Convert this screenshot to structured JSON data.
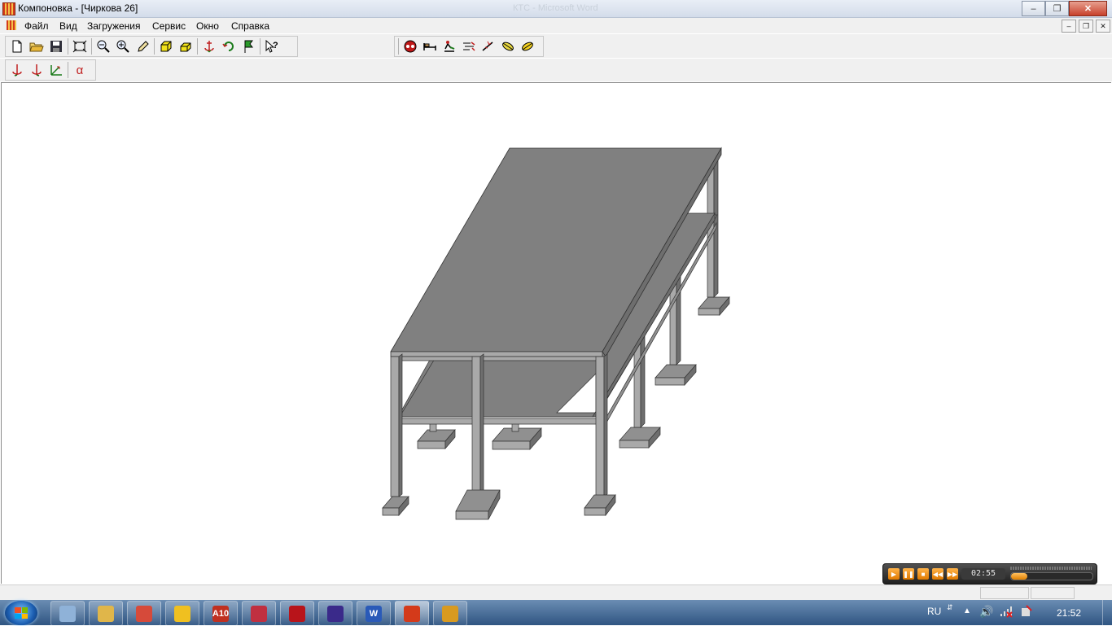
{
  "window": {
    "title": "Компоновка - [Чиркова 26]",
    "ghost_title": "КТС - Microsoft Word",
    "minimize_glyph": "–",
    "maximize_glyph": "❐",
    "close_glyph": "✕"
  },
  "menu": {
    "items": [
      {
        "label": "Файл"
      },
      {
        "label": "Вид"
      },
      {
        "label": "Загружения"
      },
      {
        "label": "Сервис"
      },
      {
        "label": "Окно"
      },
      {
        "label": "Справка"
      }
    ],
    "mdi_minimize": "–",
    "mdi_restore": "❐",
    "mdi_close": "✕"
  },
  "toolbar1": {
    "icons": [
      "new-file-icon",
      "open-folder-icon",
      "save-icon",
      "fit-view-icon",
      "zoom-out-icon",
      "zoom-in-icon",
      "pencil-icon",
      "cube-yellow-icon",
      "cube-flat-icon",
      "anchor-icon",
      "rotate-icon",
      "flag-icon",
      "help-cursor-icon"
    ]
  },
  "toolbar2": {
    "icons": [
      "load-mask-icon",
      "load-bed-icon",
      "load-person-icon",
      "load-wind-icon",
      "load-snow-icon",
      "load-leaf-icon",
      "load-leaf-yellow-icon"
    ]
  },
  "toolbar3": {
    "icons": [
      "axis-anchor-icon",
      "axis-anchor2-icon",
      "axes-icon"
    ],
    "alpha_label": "α"
  },
  "player": {
    "time": "02:55",
    "progress": 0.2
  },
  "taskbar": {
    "apps": [
      {
        "icon": "calculator-icon",
        "label": "",
        "color": "#8fb2d8"
      },
      {
        "icon": "explorer-icon",
        "label": "",
        "color": "#e0b64a"
      },
      {
        "icon": "chrome-icon",
        "label": "",
        "color": "#d64a3a"
      },
      {
        "icon": "yandex-icon",
        "label": "",
        "color": "#f0c020"
      },
      {
        "icon": "archicad-icon",
        "label": "A10",
        "color": "#c03020"
      },
      {
        "icon": "image-viewer-icon",
        "label": "",
        "color": "#c03040"
      },
      {
        "icon": "pdf-reader-icon",
        "label": "",
        "color": "#b8141a"
      },
      {
        "icon": "video-app-icon",
        "label": "",
        "color": "#3a2a8a"
      },
      {
        "icon": "word-icon",
        "label": "W",
        "color": "#2a5ab8"
      },
      {
        "icon": "kompanovka-icon",
        "label": "",
        "color": "#d43a1a"
      },
      {
        "icon": "cd-burner-icon",
        "label": "",
        "color": "#d89a20"
      }
    ],
    "language": "RU",
    "clock": "21:52"
  },
  "colors": {
    "model_top": "#808080",
    "model_front": "#a9a9a9",
    "model_side": "#6e6e6e"
  }
}
